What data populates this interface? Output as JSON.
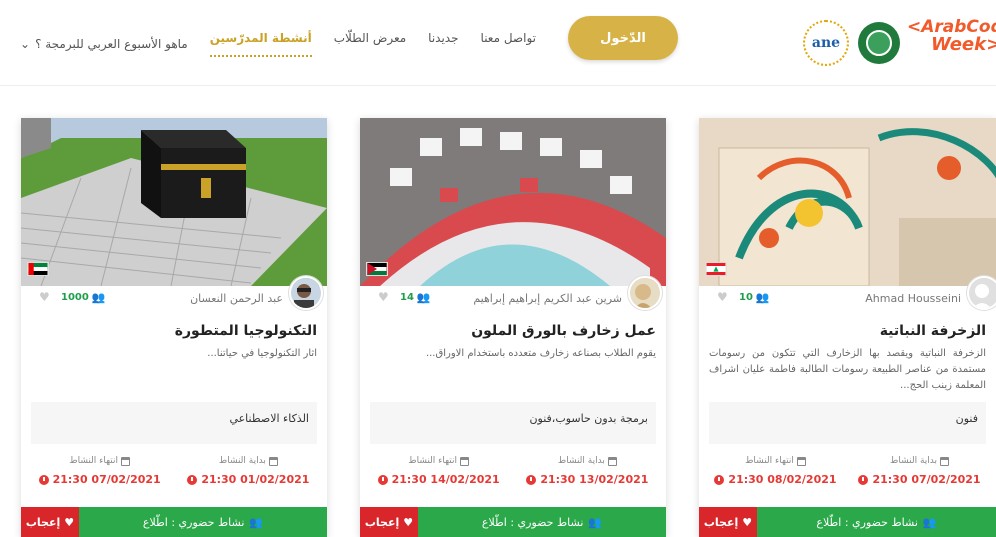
{
  "header": {
    "nav": {
      "contact": "تواصل معنا",
      "new": "جديدنا",
      "students_gallery": "معرض الطلّاب",
      "teacher_activities": "أنشطة المدرّسين",
      "about": "ماهو الأسبوع العربي للبرمجة ؟",
      "about_chevron": "⌄"
    },
    "login_label": "الدّخول",
    "logos": {
      "alecso": "ane",
      "acw_line1": "<ArabCode",
      "acw_line2": "Week>"
    }
  },
  "cards": [
    {
      "title": "التكنولوجيا المتطورة",
      "author": "عبد الرحمن النعسان",
      "count": "1000",
      "description": "اثار التكنولوجيا في حياتنا...",
      "tags": "الذكاء الاصطناعي",
      "start_label": "بداية النشاط",
      "end_label": "انتهاء النشاط",
      "start_date": "21:30 01/02/2021",
      "end_date": "21:30 07/02/2021",
      "mode": "نشاط حضوري : اطّلاع",
      "like": "إعجاب",
      "flag": "uae",
      "icons": {
        "people": "people-icon",
        "heart": "heart-icon",
        "calendar": "calendar-icon",
        "clock": "clock-icon"
      }
    },
    {
      "title": "عمل زخارف بالورق الملون",
      "author": "شرين عبد الكريم إبراهيم إبراهيم",
      "count": "14",
      "description": "يقوم الطلاب بصناعه زخارف متعدده باستخدام الاوراق...",
      "tags": "برمجة بدون حاسوب،فنون",
      "start_label": "بداية النشاط",
      "end_label": "انتهاء النشاط",
      "start_date": "21:30 13/02/2021",
      "end_date": "21:30 14/02/2021",
      "mode": "نشاط حضوري : اطّلاع",
      "like": "إعجاب",
      "flag": "jordan"
    },
    {
      "title": "الزخرفة النباتية",
      "author": "Ahmad Housseini",
      "count": "10",
      "description": "الزخرفة النباتية ويقصد بها الزخارف التي تتكون من رسومات مستمدة من عناصر الطبيعة رسومات الطالبة فاطمة عليان اشراف المعلمة زينب الحج...",
      "tags": "فنون",
      "start_label": "بداية النشاط",
      "end_label": "انتهاء النشاط",
      "start_date": "21:30 07/02/2021",
      "end_date": "21:30 08/02/2021",
      "mode": "نشاط حضوري : اطّلاع",
      "like": "إعجاب",
      "flag": "lebanon"
    }
  ],
  "colors": {
    "gold": "#d7b347",
    "green": "#2aa84a",
    "red": "#d8262b",
    "date_red": "#e53935"
  }
}
